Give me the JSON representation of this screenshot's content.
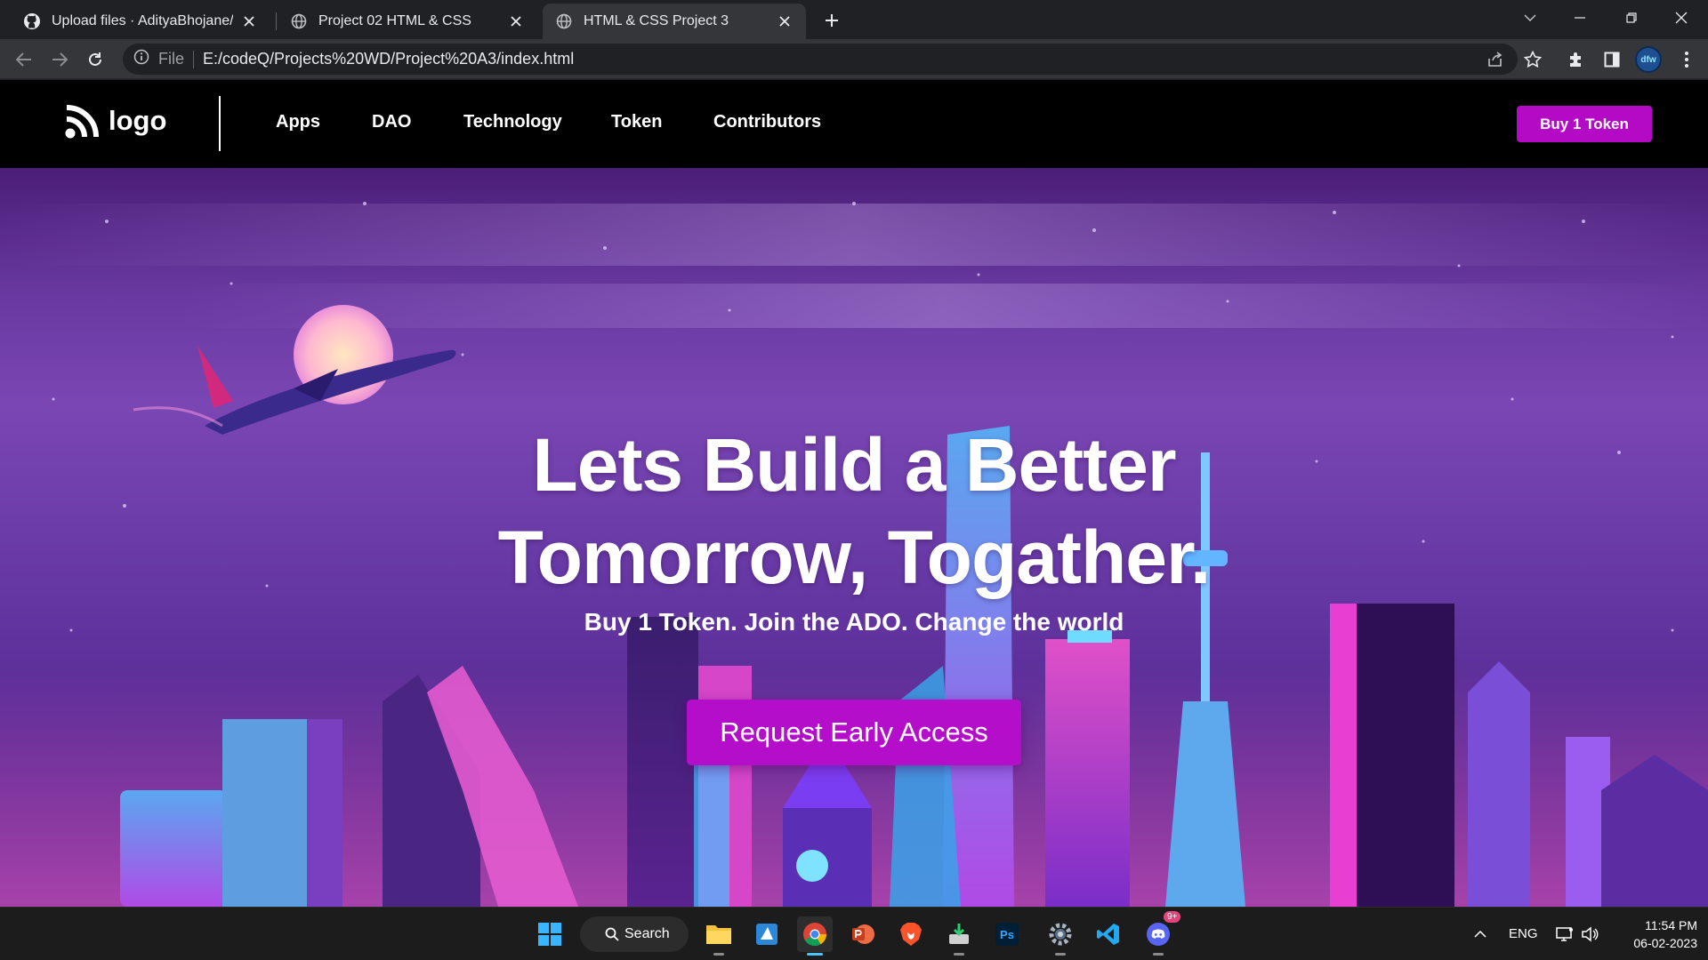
{
  "browser": {
    "tabs": [
      {
        "title": "Upload files · AdityaBhojane/HTM",
        "icon": "github-icon",
        "active": false
      },
      {
        "title": "Project 02 HTML & CSS",
        "icon": "globe-icon",
        "active": false
      },
      {
        "title": "HTML & CSS Project 3",
        "icon": "globe-icon",
        "active": true
      }
    ],
    "scheme_label": "File",
    "url": "E:/codeQ/Projects%20WD/Project%20A3/index.html",
    "profile_badge": "dfw"
  },
  "site": {
    "logo_text": "logo",
    "nav_links": [
      "Apps",
      "DAO",
      "Technology",
      "Token",
      "Contributors"
    ],
    "buy_button": "Buy 1 Token",
    "hero": {
      "title_line1": "Lets Build a Better",
      "title_line2": "Tomorrow, Togather.",
      "subtitle": "Buy 1 Token. Join the ADO. Change the world",
      "cta": "Request Early Access"
    },
    "colors": {
      "accent": "#b50ecb",
      "nav_bg": "#000000",
      "hero_purple": "#6a3aa2"
    }
  },
  "taskbar": {
    "search_label": "Search",
    "apps": [
      "start-icon",
      "file-explorer-icon",
      "windows-app-icon",
      "chrome-icon",
      "powerpoint-icon",
      "brave-icon",
      "installer-icon",
      "photoshop-icon",
      "settings-icon",
      "vscode-icon",
      "discord-icon"
    ],
    "discord_badge": "9+",
    "language": "ENG",
    "time": "11:54 PM",
    "date": "06-02-2023"
  }
}
